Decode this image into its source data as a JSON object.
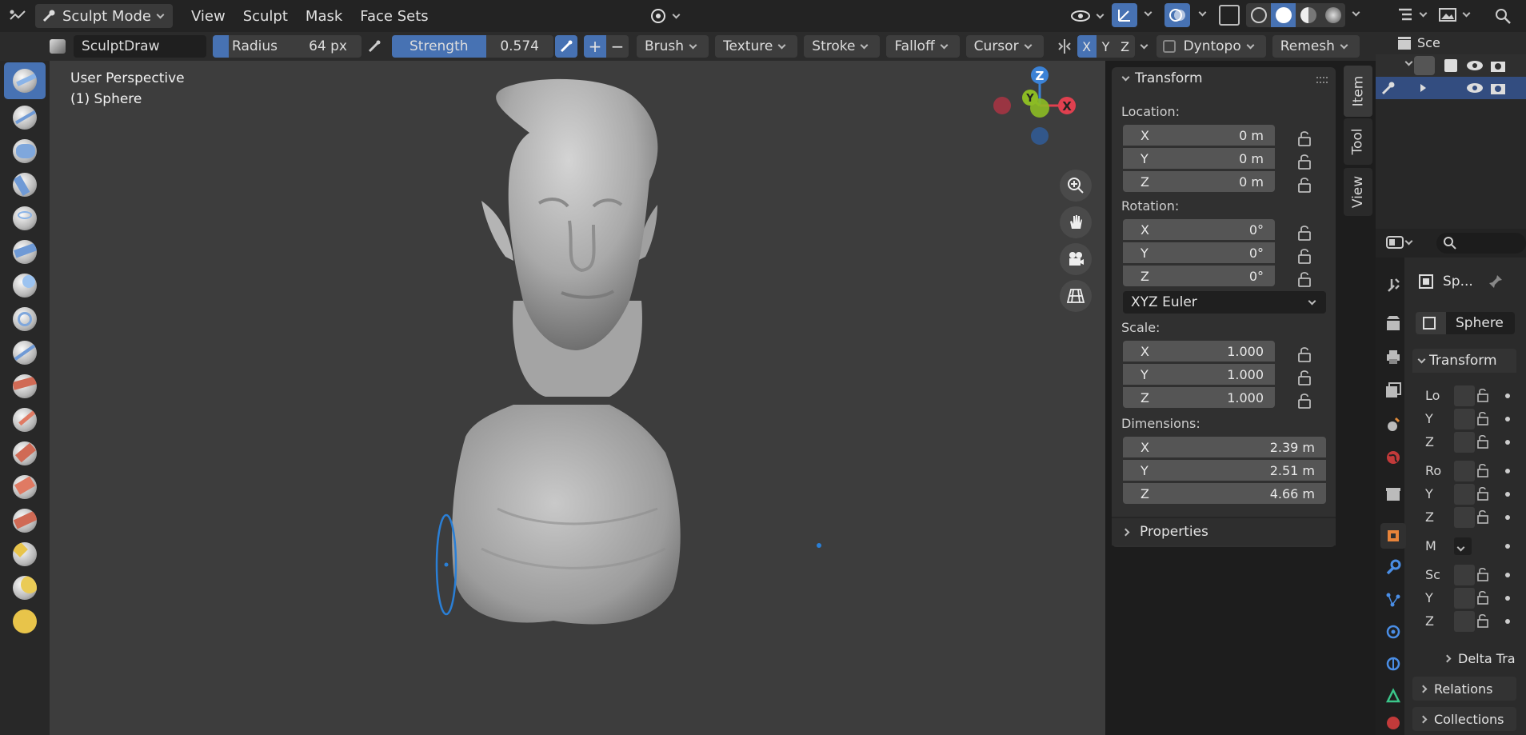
{
  "header": {
    "mode_label": "Sculpt Mode",
    "menus": [
      "View",
      "Sculpt",
      "Mask",
      "Face Sets"
    ]
  },
  "toolbar": {
    "brush_name": "SculptDraw",
    "radius_label": "Radius",
    "radius_value": "64 px",
    "strength_label": "Strength",
    "strength_value": "0.574",
    "strength_fraction": 0.574,
    "plus": "+",
    "minus": "−",
    "dropdowns": [
      "Brush",
      "Texture",
      "Stroke",
      "Falloff",
      "Cursor"
    ],
    "axes": [
      "X",
      "Y",
      "Z"
    ],
    "dyntopo_label": "Dyntopo",
    "remesh_label": "Remesh"
  },
  "viewport": {
    "perspective_label": "User Perspective",
    "object_label": "(1) Sphere",
    "gizmo": {
      "x": "X",
      "y": "Y",
      "z": "Z"
    }
  },
  "transform_panel": {
    "title": "Transform",
    "location_label": "Location:",
    "location": [
      {
        "axis": "X",
        "value": "0 m"
      },
      {
        "axis": "Y",
        "value": "0 m"
      },
      {
        "axis": "Z",
        "value": "0 m"
      }
    ],
    "rotation_label": "Rotation:",
    "rotation": [
      {
        "axis": "X",
        "value": "0°"
      },
      {
        "axis": "Y",
        "value": "0°"
      },
      {
        "axis": "Z",
        "value": "0°"
      }
    ],
    "rotation_mode": "XYZ Euler",
    "scale_label": "Scale:",
    "scale": [
      {
        "axis": "X",
        "value": "1.000"
      },
      {
        "axis": "Y",
        "value": "1.000"
      },
      {
        "axis": "Z",
        "value": "1.000"
      }
    ],
    "dimensions_label": "Dimensions:",
    "dimensions": [
      {
        "axis": "X",
        "value": "2.39 m"
      },
      {
        "axis": "Y",
        "value": "2.51 m"
      },
      {
        "axis": "Z",
        "value": "4.66 m"
      }
    ],
    "properties_label": "Properties"
  },
  "side_tabs": {
    "item": "Item",
    "tool": "Tool",
    "view": "View"
  },
  "outliner": {
    "scene_label": "Sce"
  },
  "properties_editor": {
    "object_short": "Sp...",
    "object_name": "Sphere",
    "transform_label": "Transform",
    "rows": [
      "Lo",
      "Y",
      "Z",
      "Ro",
      "Y",
      "Z",
      "M",
      "Sc",
      "Y",
      "Z"
    ],
    "delta_label": "Delta Tra",
    "relations_label": "Relations",
    "collections_label": "Collections"
  },
  "colors": {
    "accent": "#4772b3",
    "x_axis": "#e0404f",
    "y_axis": "#8cbb24",
    "z_axis": "#3b82d6",
    "brush_circle": "#2a7fd6"
  }
}
